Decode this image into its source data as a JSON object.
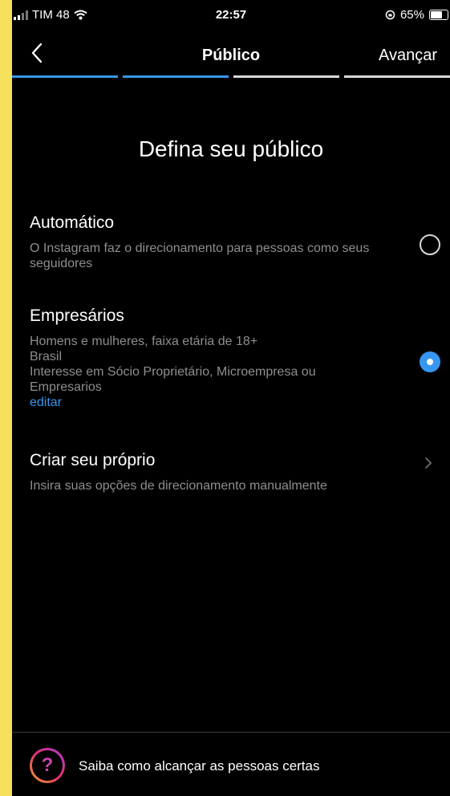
{
  "status": {
    "carrier": "TIM 48",
    "time": "22:57",
    "battery": "65%"
  },
  "nav": {
    "title": "Público",
    "next_label": "Avançar",
    "progress_steps": 4,
    "progress_active": 2
  },
  "heading": "Defina seu público",
  "options": [
    {
      "title": "Automático",
      "description": "O Instagram faz o direcionamento para pessoas como seus seguidores",
      "selected": false
    },
    {
      "title": "Empresários",
      "description_lines": [
        "Homens e mulheres, faixa etária de 18+",
        "Brasil",
        "Interesse em Sócio Proprietário, Microempresa ou Empresarios"
      ],
      "edit_label": "editar",
      "selected": true
    },
    {
      "title": "Criar seu próprio",
      "description": "Insira suas opções de direcionamento manualmente"
    }
  ],
  "footer": {
    "help_text": "Saiba como alcançar as pessoas certas"
  },
  "colors": {
    "accent": "#3796f0",
    "background": "#000000",
    "frame": "#f5e05c"
  }
}
